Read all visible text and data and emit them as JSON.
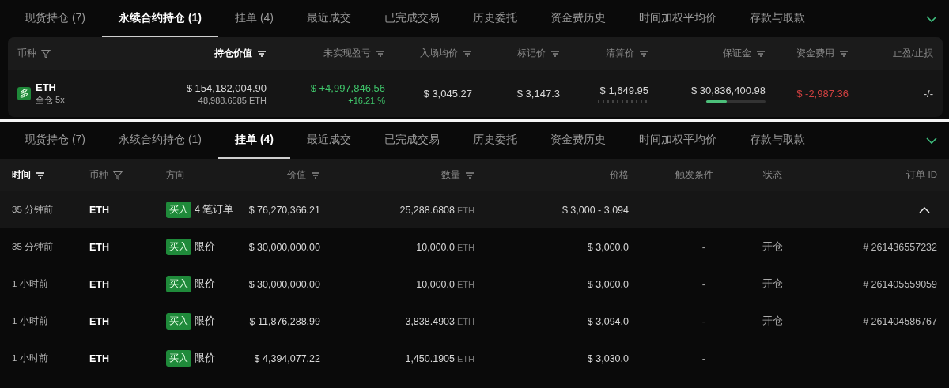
{
  "positions_panel": {
    "tabs": [
      {
        "label": "现货持仓 (7)",
        "selected": false
      },
      {
        "label": "永续合约持仓 (1)",
        "selected": true
      },
      {
        "label": "挂单 (4)",
        "selected": false
      },
      {
        "label": "最近成交",
        "selected": false
      },
      {
        "label": "已完成交易",
        "selected": false
      },
      {
        "label": "历史委托",
        "selected": false
      },
      {
        "label": "资金费历史",
        "selected": false
      },
      {
        "label": "时间加权平均价",
        "selected": false
      },
      {
        "label": "存款与取款",
        "selected": false
      }
    ],
    "columns": [
      {
        "label": "币种",
        "kind": "filter",
        "sorted": false
      },
      {
        "label": "持仓价值",
        "kind": "sort",
        "sorted": true
      },
      {
        "label": "未实现盈亏",
        "kind": "sort",
        "sorted": false
      },
      {
        "label": "入场均价",
        "kind": "sort",
        "sorted": false
      },
      {
        "label": "标记价",
        "kind": "sort",
        "sorted": false
      },
      {
        "label": "清算价",
        "kind": "sort",
        "sorted": false
      },
      {
        "label": "保证金",
        "kind": "sort",
        "sorted": false
      },
      {
        "label": "资金费用",
        "kind": "sort",
        "sorted": false
      },
      {
        "label": "止盈/止损",
        "kind": "text",
        "sorted": false
      }
    ],
    "rows": [
      {
        "side_badge": "多",
        "coin": "ETH",
        "margin_mode": "全仓 5x",
        "position_value": "$ 154,182,004.90",
        "position_size": "48,988.6585 ETH",
        "pnl": "$ +4,997,846.56",
        "pnl_pct": "+16.21 %",
        "pnl_positive": true,
        "entry_price": "$ 3,045.27",
        "mark_price": "$ 3,147.3",
        "liq_price": "$ 1,649.95",
        "margin": "$ 30,836,400.98",
        "margin_bar": {
          "level": 0.35
        },
        "funding": "$ -2,987.36",
        "funding_positive": false,
        "tp_sl": "-/-"
      }
    ]
  },
  "orders_panel": {
    "tabs": [
      {
        "label": "现货持仓 (7)",
        "selected": false
      },
      {
        "label": "永续合约持仓 (1)",
        "selected": false
      },
      {
        "label": "挂单 (4)",
        "selected": true
      },
      {
        "label": "最近成交",
        "selected": false
      },
      {
        "label": "已完成交易",
        "selected": false
      },
      {
        "label": "历史委托",
        "selected": false
      },
      {
        "label": "资金费历史",
        "selected": false
      },
      {
        "label": "时间加权平均价",
        "selected": false
      },
      {
        "label": "存款与取款",
        "selected": false
      }
    ],
    "columns": [
      {
        "label": "时间",
        "kind": "sort",
        "sorted": true
      },
      {
        "label": "币种",
        "kind": "filter",
        "sorted": false
      },
      {
        "label": "方向",
        "kind": "text",
        "sorted": false
      },
      {
        "label": "价值",
        "kind": "sort",
        "sorted": false
      },
      {
        "label": "数量",
        "kind": "sort",
        "sorted": false
      },
      {
        "label": "价格",
        "kind": "text",
        "sorted": false
      },
      {
        "label": "触发条件",
        "kind": "text",
        "sorted": false
      },
      {
        "label": "状态",
        "kind": "text",
        "sorted": false
      },
      {
        "label": "订单 ID",
        "kind": "text",
        "sorted": false
      }
    ],
    "orders": [
      {
        "time": "35 分钟前",
        "coin": "ETH",
        "side": "买入",
        "type": "4 笔订单",
        "value": "$ 76,270,366.21",
        "quantity": "25,288.6808",
        "unit": "ETH",
        "price": "$ 3,000 - 3,094",
        "expanded": true,
        "children": [
          {
            "time": "35 分钟前",
            "coin": "ETH",
            "side": "买入",
            "type": "限价",
            "value": "$ 30,000,000.00",
            "quantity": "10,000.0",
            "unit": "ETH",
            "price": "$ 3,000.0",
            "trigger": "-",
            "status": "开仓",
            "order_id": "# 261436557232"
          },
          {
            "time": "1 小时前",
            "coin": "ETH",
            "side": "买入",
            "type": "限价",
            "value": "$ 30,000,000.00",
            "quantity": "10,000.0",
            "unit": "ETH",
            "price": "$ 3,000.0",
            "trigger": "-",
            "status": "开仓",
            "order_id": "# 261405559059"
          },
          {
            "time": "1 小时前",
            "coin": "ETH",
            "side": "买入",
            "type": "限价",
            "value": "$ 11,876,288.99",
            "quantity": "3,838.4903",
            "unit": "ETH",
            "price": "$ 3,094.0",
            "trigger": "-",
            "status": "开仓",
            "order_id": "# 261404586767"
          },
          {
            "time": "1 小时前",
            "coin": "ETH",
            "side": "买入",
            "type": "限价",
            "value": "$ 4,394,077.22",
            "quantity": "1,450.1905",
            "unit": "ETH",
            "price": "$ 3,030.0",
            "trigger": "-"
          }
        ]
      }
    ]
  }
}
